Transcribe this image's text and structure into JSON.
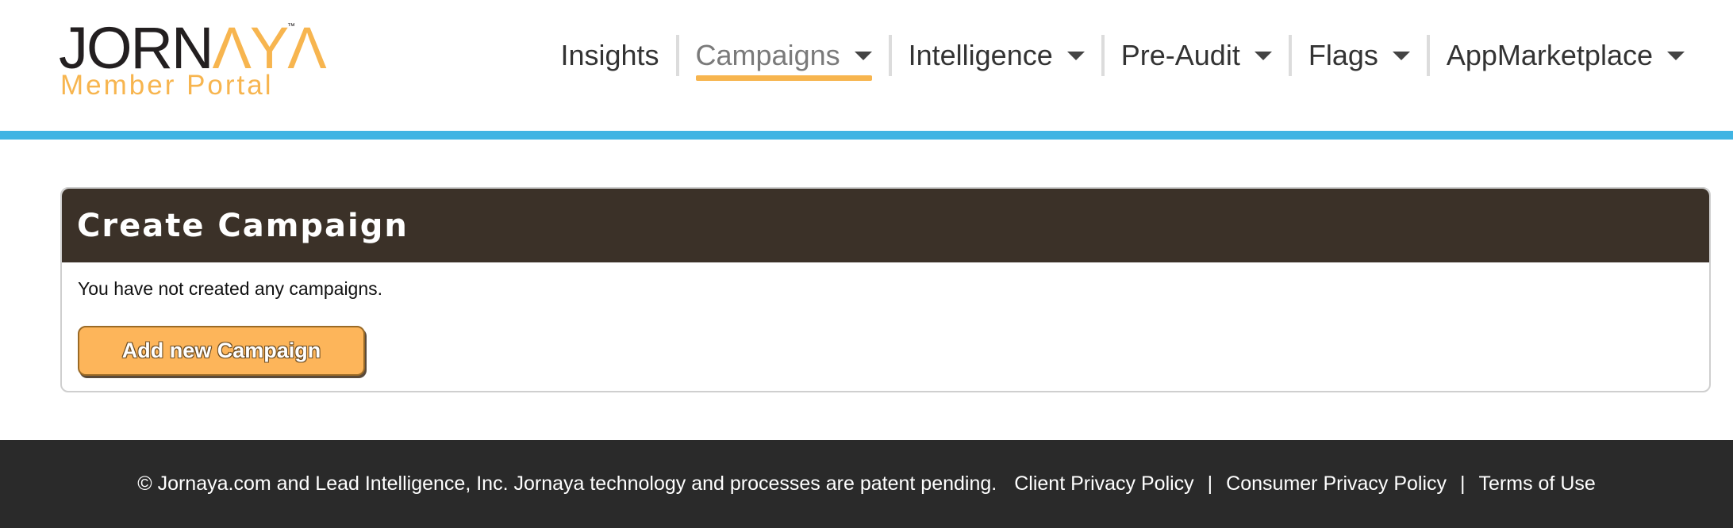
{
  "brand": {
    "logo_word_left": "JORN",
    "logo_word_accent": "ΛY",
    "logo_word_end": "Λ",
    "logo_tm": "™",
    "logo_sub": "Member Portal",
    "brand_color": "#f7b54f",
    "accent_bar_color": "#3fb4e3"
  },
  "nav": {
    "items": [
      {
        "label": "Insights",
        "has_dropdown": false,
        "active": false
      },
      {
        "label": "Campaigns",
        "has_dropdown": true,
        "active": true
      },
      {
        "label": "Intelligence",
        "has_dropdown": true,
        "active": false
      },
      {
        "label": "Pre-Audit",
        "has_dropdown": true,
        "active": false
      },
      {
        "label": "Flags",
        "has_dropdown": true,
        "active": false
      },
      {
        "label": "AppMarketplace",
        "has_dropdown": true,
        "active": false
      }
    ]
  },
  "panel": {
    "title": "Create Campaign",
    "message": "You have not created any campaigns.",
    "add_button_label": "Add new Campaign"
  },
  "footer": {
    "copyright": "© Jornaya.com and Lead Intelligence, Inc. Jornaya technology and processes are patent pending.",
    "separator": "|",
    "links": [
      "Client Privacy Policy",
      "Consumer Privacy Policy",
      "Terms of Use"
    ]
  }
}
